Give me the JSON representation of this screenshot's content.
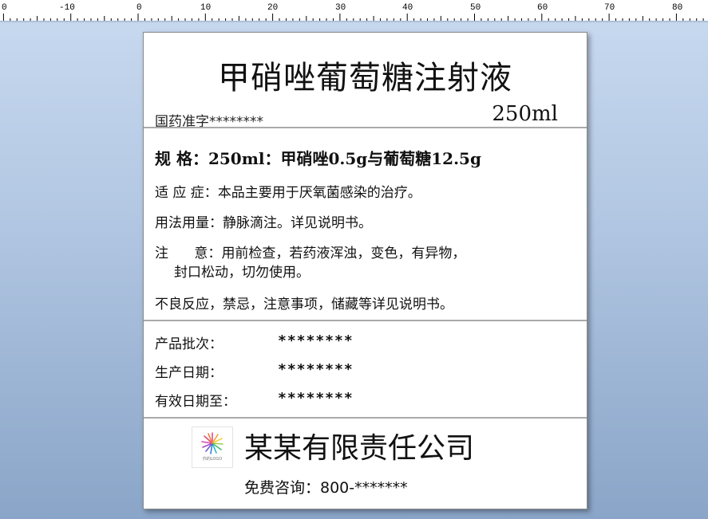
{
  "ruler": {
    "labels": [
      "0",
      "-10",
      "0",
      "10",
      "20",
      "30",
      "40",
      "50",
      "60",
      "70",
      "80"
    ]
  },
  "label": {
    "title": "甲硝唑葡萄糖注射液",
    "approval_no": "国药准字********",
    "volume": "250ml",
    "spec": "规   格：250ml：甲硝唑0.5g与葡萄糖12.5g",
    "indication": {
      "label": "适 应 症：",
      "value": "本品主要用于厌氧菌感染的治疗。"
    },
    "usage": {
      "label": "用法用量：",
      "value": "静脉滴注。详见说明书。"
    },
    "caution": {
      "label": "注      意：",
      "value": "用前检查，若药液浑浊，变色，有异物，",
      "value_cont": "封口松动，切勿使用。"
    },
    "adverse": "不良反应，禁忌，注意事项，储藏等详见说明书。",
    "batch": {
      "label": "产品批次：",
      "value": "********"
    },
    "mfg_date": {
      "label": "生产日期：",
      "value": "********"
    },
    "expiry": {
      "label": "有效日期至：",
      "value": "********"
    },
    "logo_text": "你的LOGO",
    "company": "某某有限责任公司",
    "hotline": "免费咨询：800-*******"
  }
}
